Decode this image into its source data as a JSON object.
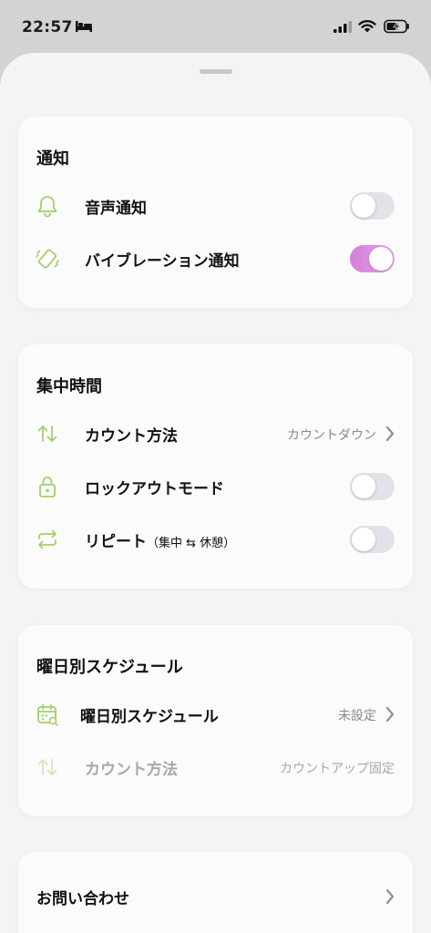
{
  "status_bar": {
    "time": "22:57"
  },
  "colors": {
    "accent_green": "#a3d06b",
    "toggle_on": "#d88ee0",
    "toggle_off": "#e1e3e8"
  },
  "notifications": {
    "title": "通知",
    "sound": {
      "label": "音声通知",
      "icon": "bell-icon",
      "enabled": false
    },
    "vibration": {
      "label": "バイブレーション通知",
      "icon": "vibration-icon",
      "enabled": true
    }
  },
  "focus_time": {
    "title": "集中時間",
    "count_method": {
      "label": "カウント方法",
      "value": "カウントダウン",
      "icon": "up-down-arrows-icon"
    },
    "lockout": {
      "label": "ロックアウトモード",
      "icon": "lock-icon",
      "enabled": false
    },
    "repeat": {
      "label": "リピート",
      "sub": "（集中 ⇆ 休憩）",
      "icon": "repeat-icon",
      "enabled": false
    }
  },
  "weekday_schedule": {
    "title": "曜日別スケジュール",
    "schedule": {
      "label": "曜日別スケジュール",
      "value": "未設定",
      "icon": "calendar-icon"
    },
    "count_method": {
      "label": "カウント方法",
      "value": "カウントアップ固定",
      "icon": "up-down-arrows-icon"
    }
  },
  "contact": {
    "label": "お問い合わせ"
  }
}
